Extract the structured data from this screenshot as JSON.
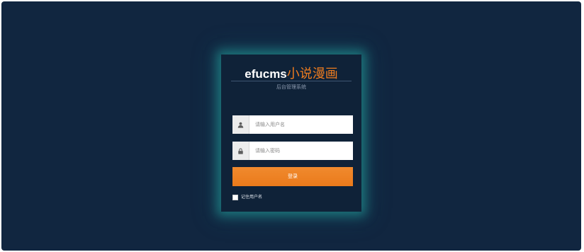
{
  "brand": {
    "name_en": "efucms",
    "name_zh": "小说漫画",
    "subtitle": "后台管理系统"
  },
  "form": {
    "username_placeholder": "请输入用户名",
    "password_placeholder": "请输入密码",
    "login_label": "登录",
    "remember_label": "记住用户名",
    "remember_checked": false
  },
  "icons": {
    "username": "user-icon",
    "password": "lock-icon"
  },
  "colors": {
    "background": "#112640",
    "card": "#0f2238",
    "accent": "#ee7c1f",
    "glow": "#24a8a0"
  }
}
